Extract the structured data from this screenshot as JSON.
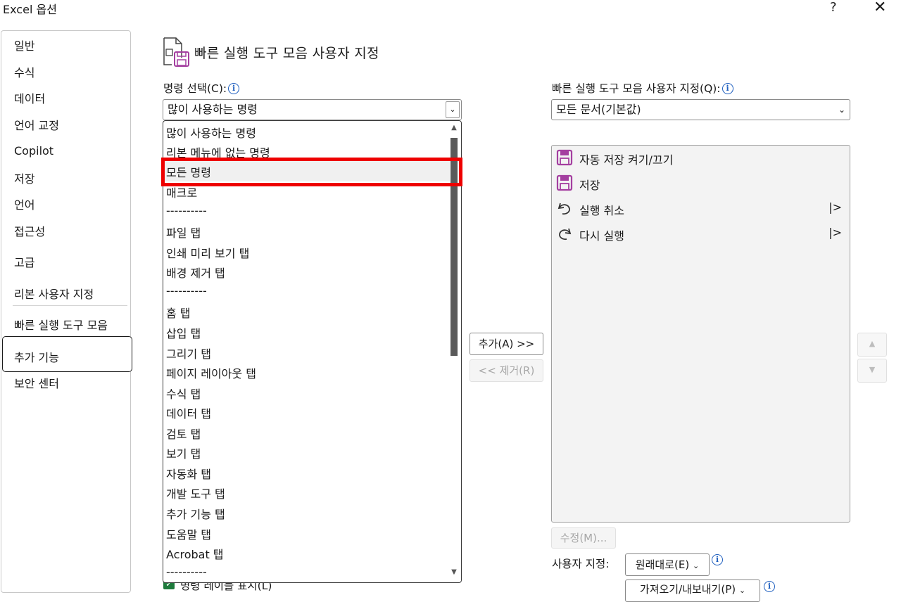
{
  "window": {
    "title": "Excel 옵션",
    "help": "?",
    "close": "✕"
  },
  "nav": {
    "items": [
      "일반",
      "수식",
      "데이터",
      "언어 교정",
      "Copilot",
      "저장",
      "언어",
      "접근성",
      "고급",
      "리본 사용자 지정",
      "빠른 실행 도구 모음",
      "추가 기능",
      "보안 센터"
    ],
    "selected": "빠른 실행 도구 모음"
  },
  "heading": "빠른 실행 도구 모음 사용자 지정",
  "choose": {
    "label": "명령 선택(C):",
    "value": "많이 사용하는 명령",
    "options": [
      "많이 사용하는 명령",
      "리본 메뉴에 없는 명령",
      "모든 명령",
      "매크로",
      "----------",
      "파일 탭",
      "인쇄 미리 보기 탭",
      "배경 제거 탭",
      "----------",
      "홈 탭",
      "삽입 탭",
      "그리기 탭",
      "페이지 레이아웃 탭",
      "수식 탭",
      "데이터 탭",
      "검토 탭",
      "보기 탭",
      "자동화 탭",
      "개발 도구 탭",
      "추가 기능 탭",
      "도움말 탭",
      "Acrobat 탭",
      "----------"
    ],
    "highlighted": "모든 명령"
  },
  "customize": {
    "label": "빠른 실행 도구 모음 사용자 지정(Q):",
    "value": "모든 문서(기본값)",
    "items": [
      {
        "label": "자동 저장 켜기/끄기",
        "icon": "autosave-icon",
        "submenu": ""
      },
      {
        "label": "저장",
        "icon": "save-icon",
        "submenu": ""
      },
      {
        "label": "실행 취소",
        "icon": "undo-icon",
        "submenu": "|>"
      },
      {
        "label": "다시 실행",
        "icon": "redo-icon",
        "submenu": "|>"
      }
    ]
  },
  "buttons": {
    "add": "추가(A) >>",
    "remove": "<< 제거(R)",
    "modify": "수정(M)...",
    "up": "▲",
    "down": "▼"
  },
  "custom_label": "사용자 지정:",
  "reset": "원래대로(E)",
  "import_export": "가져오기/내보내기(P)",
  "bottom_check": "명령 레이블 표시(L)",
  "colors": {
    "accent_red": "#ee0000",
    "save_purple": "#a43fa0",
    "info_blue": "#1f5fbf"
  }
}
